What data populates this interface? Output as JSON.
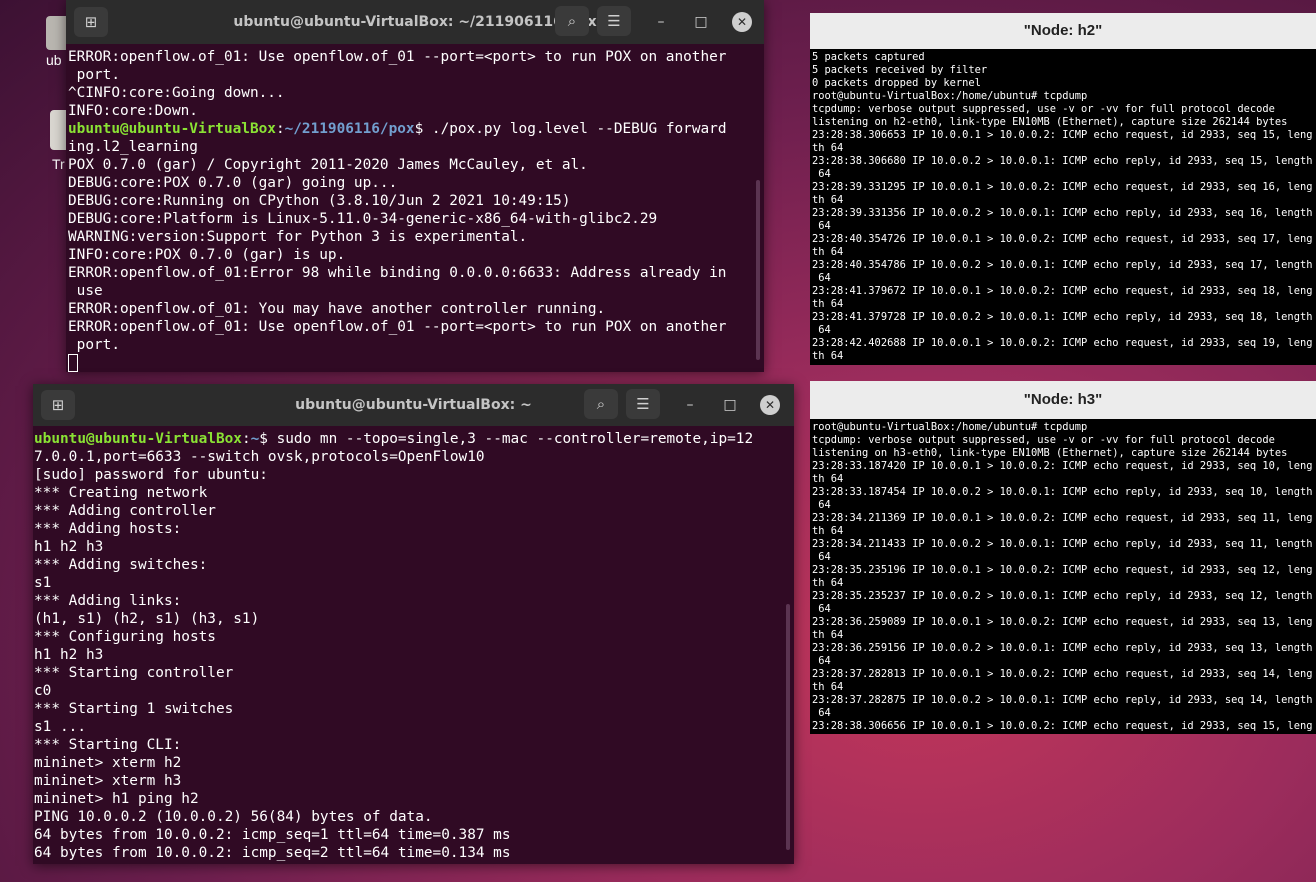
{
  "desktop": {
    "icons": [
      {
        "label": "ub",
        "icon": "home-folder-icon"
      },
      {
        "label": "Tr",
        "icon": "trash-icon"
      }
    ]
  },
  "term_pox": {
    "title": "ubuntu@ubuntu-VirtualBox: ~/211906116/pox",
    "lines_before": [
      "ERROR:openflow.of_01: Use openflow.of_01 --port=<port> to run POX on another",
      " port.",
      "^CINFO:core:Going down...",
      "INFO:core:Down."
    ],
    "prompt_user": "ubuntu@ubuntu-VirtualBox",
    "prompt_colon": ":",
    "prompt_path": "~/211906116/pox",
    "prompt_dollar": "$ ",
    "command": "./pox.py log.level --DEBUG forward",
    "lines_after": [
      "ing.l2_learning",
      "POX 0.7.0 (gar) / Copyright 2011-2020 James McCauley, et al.",
      "DEBUG:core:POX 0.7.0 (gar) going up...",
      "DEBUG:core:Running on CPython (3.8.10/Jun 2 2021 10:49:15)",
      "DEBUG:core:Platform is Linux-5.11.0-34-generic-x86_64-with-glibc2.29",
      "WARNING:version:Support for Python 3 is experimental.",
      "INFO:core:POX 0.7.0 (gar) is up.",
      "ERROR:openflow.of_01:Error 98 while binding 0.0.0.0:6633: Address already in",
      " use",
      "ERROR:openflow.of_01: You may have another controller running.",
      "ERROR:openflow.of_01: Use openflow.of_01 --port=<port> to run POX on another",
      " port."
    ]
  },
  "term_mn": {
    "title": "ubuntu@ubuntu-VirtualBox: ~",
    "prompt_user": "ubuntu@ubuntu-VirtualBox",
    "prompt_colon": ":",
    "prompt_path": "~",
    "prompt_dollar": "$ ",
    "command": "sudo mn --topo=single,3 --mac --controller=remote,ip=12",
    "lines_after": [
      "7.0.0.1,port=6633 --switch ovsk,protocols=OpenFlow10",
      "[sudo] password for ubuntu:",
      "*** Creating network",
      "*** Adding controller",
      "*** Adding hosts:",
      "h1 h2 h3",
      "*** Adding switches:",
      "s1",
      "*** Adding links:",
      "(h1, s1) (h2, s1) (h3, s1)",
      "*** Configuring hosts",
      "h1 h2 h3",
      "*** Starting controller",
      "c0",
      "*** Starting 1 switches",
      "s1 ...",
      "*** Starting CLI:",
      "mininet> xterm h2",
      "mininet> xterm h3",
      "mininet> h1 ping h2",
      "PING 10.0.0.2 (10.0.0.2) 56(84) bytes of data.",
      "64 bytes from 10.0.0.2: icmp_seq=1 ttl=64 time=0.387 ms",
      "64 bytes from 10.0.0.2: icmp_seq=2 ttl=64 time=0.134 ms"
    ]
  },
  "xterm_h2": {
    "title": "\"Node: h2\"",
    "text": "5 packets captured\n5 packets received by filter\n0 packets dropped by kernel\nroot@ubuntu-VirtualBox:/home/ubuntu# tcpdump\ntcpdump: verbose output suppressed, use -v or -vv for full protocol decode\nlistening on h2-eth0, link-type EN10MB (Ethernet), capture size 262144 bytes\n23:28:38.306653 IP 10.0.0.1 > 10.0.0.2: ICMP echo request, id 2933, seq 15, leng\nth 64\n23:28:38.306680 IP 10.0.0.2 > 10.0.0.1: ICMP echo reply, id 2933, seq 15, length\n 64\n23:28:39.331295 IP 10.0.0.1 > 10.0.0.2: ICMP echo request, id 2933, seq 16, leng\nth 64\n23:28:39.331356 IP 10.0.0.2 > 10.0.0.1: ICMP echo reply, id 2933, seq 16, length\n 64\n23:28:40.354726 IP 10.0.0.1 > 10.0.0.2: ICMP echo request, id 2933, seq 17, leng\nth 64\n23:28:40.354786 IP 10.0.0.2 > 10.0.0.1: ICMP echo reply, id 2933, seq 17, length\n 64\n23:28:41.379672 IP 10.0.0.1 > 10.0.0.2: ICMP echo request, id 2933, seq 18, leng\nth 64\n23:28:41.379728 IP 10.0.0.2 > 10.0.0.1: ICMP echo reply, id 2933, seq 18, length\n 64\n23:28:42.402688 IP 10.0.0.1 > 10.0.0.2: ICMP echo request, id 2933, seq 19, leng\nth 64"
  },
  "xterm_h3": {
    "title": "\"Node: h3\"",
    "text": "root@ubuntu-VirtualBox:/home/ubuntu# tcpdump\ntcpdump: verbose output suppressed, use -v or -vv for full protocol decode\nlistening on h3-eth0, link-type EN10MB (Ethernet), capture size 262144 bytes\n23:28:33.187420 IP 10.0.0.1 > 10.0.0.2: ICMP echo request, id 2933, seq 10, leng\nth 64\n23:28:33.187454 IP 10.0.0.2 > 10.0.0.1: ICMP echo reply, id 2933, seq 10, length\n 64\n23:28:34.211369 IP 10.0.0.1 > 10.0.0.2: ICMP echo request, id 2933, seq 11, leng\nth 64\n23:28:34.211433 IP 10.0.0.2 > 10.0.0.1: ICMP echo reply, id 2933, seq 11, length\n 64\n23:28:35.235196 IP 10.0.0.1 > 10.0.0.2: ICMP echo request, id 2933, seq 12, leng\nth 64\n23:28:35.235237 IP 10.0.0.2 > 10.0.0.1: ICMP echo reply, id 2933, seq 12, length\n 64\n23:28:36.259089 IP 10.0.0.1 > 10.0.0.2: ICMP echo request, id 2933, seq 13, leng\nth 64\n23:28:36.259156 IP 10.0.0.2 > 10.0.0.1: ICMP echo reply, id 2933, seq 13, length\n 64\n23:28:37.282813 IP 10.0.0.1 > 10.0.0.2: ICMP echo request, id 2933, seq 14, leng\nth 64\n23:28:37.282875 IP 10.0.0.2 > 10.0.0.1: ICMP echo reply, id 2933, seq 14, length\n 64\n23:28:38.306656 IP 10.0.0.1 > 10.0.0.2: ICMP echo request, id 2933, seq 15, leng"
  },
  "colors": {
    "terminal_bg": "#300a24",
    "prompt_user": "#8ae234",
    "prompt_path": "#729fcf",
    "header_bg": "#2c2c2c"
  }
}
